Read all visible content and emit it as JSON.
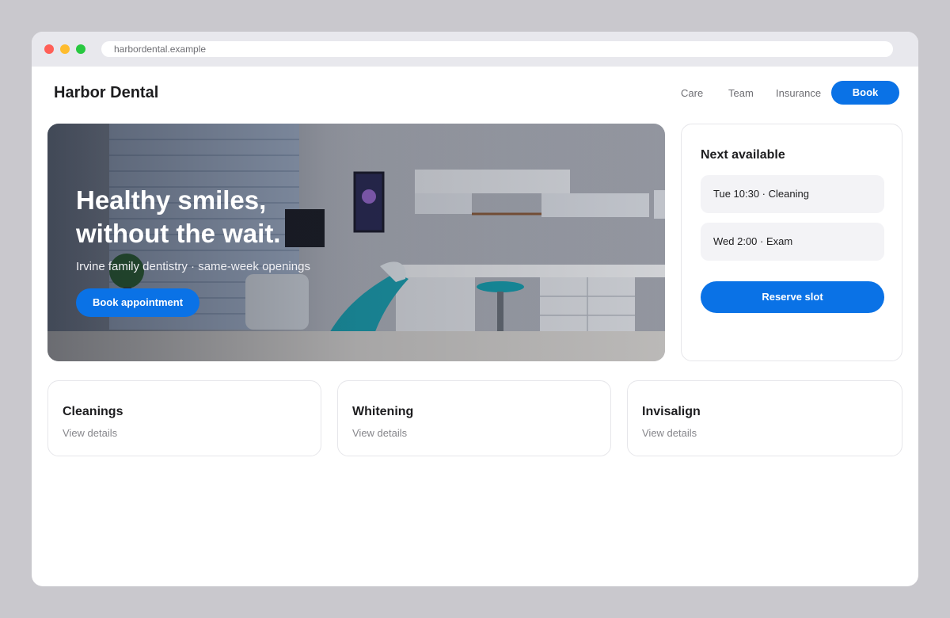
{
  "browser": {
    "url": "harbordental.example"
  },
  "nav": {
    "brand": "Harbor Dental",
    "links": [
      "Care",
      "Team",
      "Insurance"
    ],
    "cta": "Book"
  },
  "hero": {
    "title": "Healthy smiles,\nwithout the wait.",
    "subtitle": "Irvine family dentistry · same-week openings",
    "cta": "Book appointment",
    "image": "dental-office-photo"
  },
  "availability": {
    "title": "Next available",
    "slots": [
      "Tue 10:30 · Cleaning",
      "Wed 2:00 · Exam"
    ],
    "cta": "Reserve slot"
  },
  "services": [
    {
      "title": "Cleanings",
      "link": "View details"
    },
    {
      "title": "Whitening",
      "link": "View details"
    },
    {
      "title": "Invisalign",
      "link": "View details"
    }
  ],
  "colors": {
    "accent": "#0a72e6",
    "background": "#c9c8cd"
  }
}
